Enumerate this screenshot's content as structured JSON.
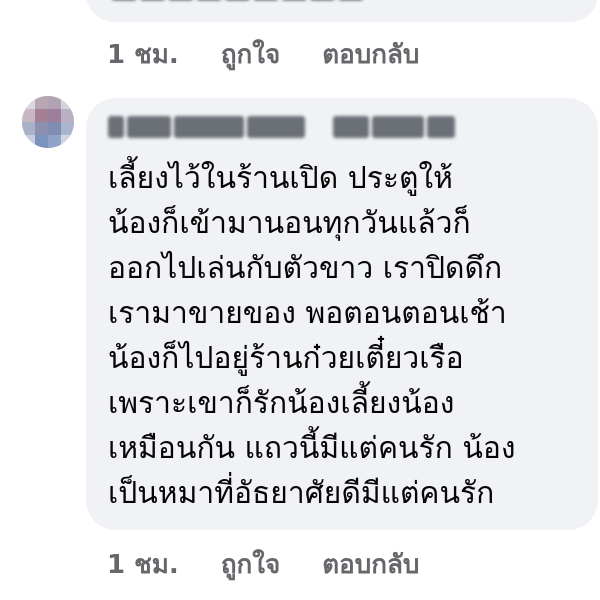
{
  "previous_comment": {
    "actions": {
      "time": "1 ชม.",
      "like": "ถูกใจ",
      "reply": "ตอบกลับ"
    }
  },
  "comment": {
    "author": {
      "name_blurred": true
    },
    "body_lines": [
      "เลี้ยงไว้ในร้านเปิด ประตูให้",
      "น้องก็เข้ามานอนทุกวันแล้วก็",
      "ออกไปเล่นกับตัวขาว เราปิดดึก",
      "เรามาขายของ พอตอนตอนเช้า",
      "น้องก็ไปอยู่ร้านก๋วยเตี๋ยวเรือ",
      "เพราะเขาก็รักน้องเลี้ยงน้อง",
      "เหมือนกัน แถวนี้มีแต่คนรัก น้อง",
      "เป็นหมาที่อัธยาศัยดีมีแต่คนรัก"
    ],
    "actions": {
      "time": "1 ชม.",
      "like": "ถูกใจ",
      "reply": "ตอบกลับ"
    }
  },
  "colors": {
    "bubble_bg": "#f0f2f5",
    "text": "#050505",
    "meta_text": "#65676b"
  }
}
